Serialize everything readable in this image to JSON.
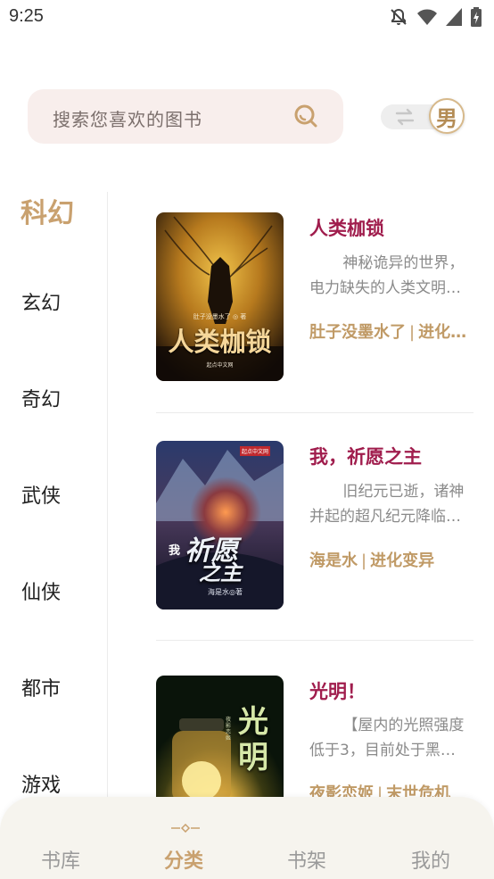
{
  "status_bar": {
    "time": "9:25"
  },
  "search": {
    "placeholder": "搜索您喜欢的图书"
  },
  "gender": {
    "label": "男"
  },
  "categories": [
    "科幻",
    "玄幻",
    "奇幻",
    "武侠",
    "仙侠",
    "都市",
    "游戏"
  ],
  "active_category": "科幻",
  "books": [
    {
      "title": "人类枷锁",
      "desc_line1": "神秘诡异的世界，",
      "desc_line2": "电力缺失的人类文明…",
      "author": "肚子没墨水了",
      "tag": "进化…",
      "cover_title": "人类枷锁",
      "cover_author": "肚子没墨水了 ◎ 著",
      "cover_badge": "起点中文网"
    },
    {
      "title": "我，祈愿之主",
      "desc_line1": "旧纪元已逝，诸神",
      "desc_line2": "并起的超凡纪元降临…",
      "author": "海是水",
      "tag": "进化变异",
      "cover_title_1": "我",
      "cover_title_2": "祈愿",
      "cover_title_3": "之主",
      "cover_author": "海是水◎著",
      "cover_badge": "起点中文网"
    },
    {
      "title": "光明！",
      "desc_line1": "【屋内的光照强度",
      "desc_line2": "低于3，目前处于黑…",
      "author": "夜影恋姬",
      "tag": "末世危机",
      "cover_title": "光明",
      "cover_author": "夜影恋姬"
    }
  ],
  "nav": {
    "items": [
      "书库",
      "分类",
      "书架",
      "我的"
    ],
    "active": "分类"
  },
  "colors": {
    "accent": "#c9a16f",
    "title": "#a01d4d",
    "search_bg": "#f8eeec",
    "nav_bg": "#f6f4ee"
  },
  "icons": [
    "mute-bell-icon",
    "wifi-icon",
    "signal-icon",
    "battery-icon",
    "search-icon",
    "swap-icon"
  ]
}
